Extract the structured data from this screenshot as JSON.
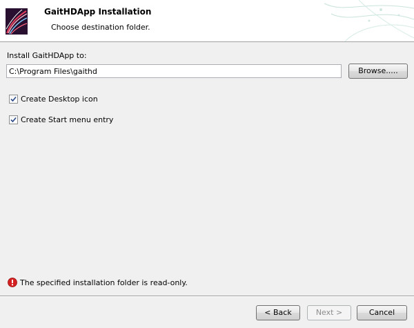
{
  "header": {
    "title": "GaitHDApp Installation",
    "subtitle": "Choose destination folder.",
    "logo_icon": "app-logo-icon"
  },
  "install": {
    "label": "Install GaitHDApp to:",
    "path_value": "C:\\Program Files\\gaithd",
    "browse_label": "Browse....."
  },
  "options": [
    {
      "label": "Create Desktop icon",
      "checked": true
    },
    {
      "label": "Create Start menu entry",
      "checked": true
    }
  ],
  "error": {
    "message": "The specified installation folder is read-only.",
    "icon": "error-icon",
    "color": "#d42020"
  },
  "footer": {
    "back_label": "< Back",
    "next_label": "Next >",
    "cancel_label": "Cancel",
    "next_enabled": false
  }
}
